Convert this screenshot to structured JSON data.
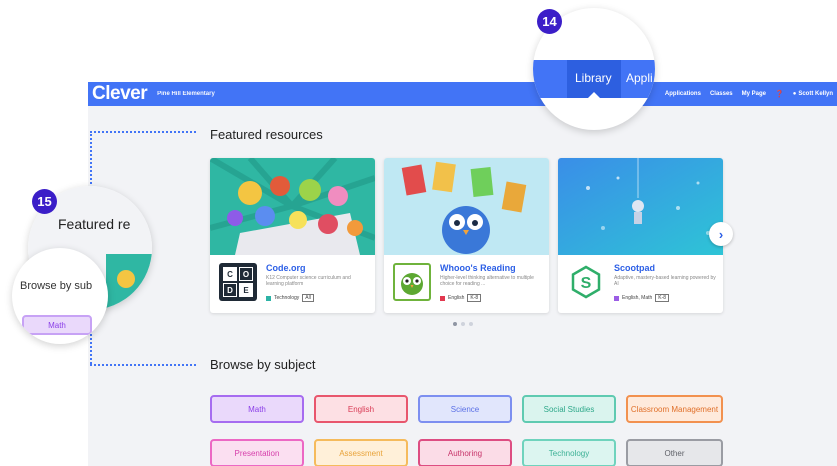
{
  "app": {
    "logo": "Clever",
    "school": "Pine Hill Elementary"
  },
  "nav": {
    "applications": "Applications",
    "classes": "Classes",
    "my_page": "My Page",
    "user": "Scott Kellyn"
  },
  "callouts": {
    "c14": {
      "number": "14",
      "tab_library": "Library",
      "tab_applications": "Appli"
    },
    "c15": {
      "number": "15",
      "featured": "Featured re",
      "browse": "Browse by sub",
      "chip": "Math"
    }
  },
  "featured": {
    "title": "Featured resources",
    "cards": [
      {
        "name": "Code.org",
        "desc": "K12 Computer science curriculum and learning platform",
        "subject": "Technology",
        "grade": "All",
        "logo_letters": [
          "C",
          "O",
          "D",
          "E"
        ],
        "tag_color": "#2db3a6"
      },
      {
        "name": "Whooo's Reading",
        "desc": "Higher-level thinking alternative to multiple choice for reading ...",
        "subject": "English",
        "grade": "K-8",
        "tag_color": "#e2384f"
      },
      {
        "name": "Scootpad",
        "desc": "Adaptive, mastery-based learning powered by AI",
        "subject": "English, Math",
        "grade": "K-8",
        "tag_color": "#9b5de5"
      }
    ]
  },
  "browse": {
    "title": "Browse by subject",
    "chips": [
      {
        "label": "Math",
        "bg": "#ead9fb",
        "border": "#a66cf0",
        "fg": "#8b3fe8"
      },
      {
        "label": "English",
        "bg": "#fde0e4",
        "border": "#e8566d",
        "fg": "#d93a54"
      },
      {
        "label": "Science",
        "bg": "#e1e6fc",
        "border": "#7d8ff0",
        "fg": "#5a6fe6"
      },
      {
        "label": "Social Studies",
        "bg": "#daf4ee",
        "border": "#5fcab1",
        "fg": "#2ea88a"
      },
      {
        "label": "Classroom Management",
        "bg": "#feeadc",
        "border": "#f2914f",
        "fg": "#e0702a"
      },
      {
        "label": "Presentation",
        "bg": "#fbdff1",
        "border": "#ec68c4",
        "fg": "#d63fab"
      },
      {
        "label": "Assessment",
        "bg": "#fff0d9",
        "border": "#f5bb5c",
        "fg": "#e8a33a"
      },
      {
        "label": "Authoring",
        "bg": "#fbdce7",
        "border": "#dd4d82",
        "fg": "#c7356a"
      },
      {
        "label": "Technology",
        "bg": "#dcf5f0",
        "border": "#6fd3bd",
        "fg": "#3cb095"
      },
      {
        "label": "Other",
        "bg": "#e6e7ea",
        "border": "#9a9ca3",
        "fg": "#5f6168"
      }
    ]
  },
  "colors": {
    "brand": "#4274f6",
    "badge": "#3b1ec8"
  }
}
